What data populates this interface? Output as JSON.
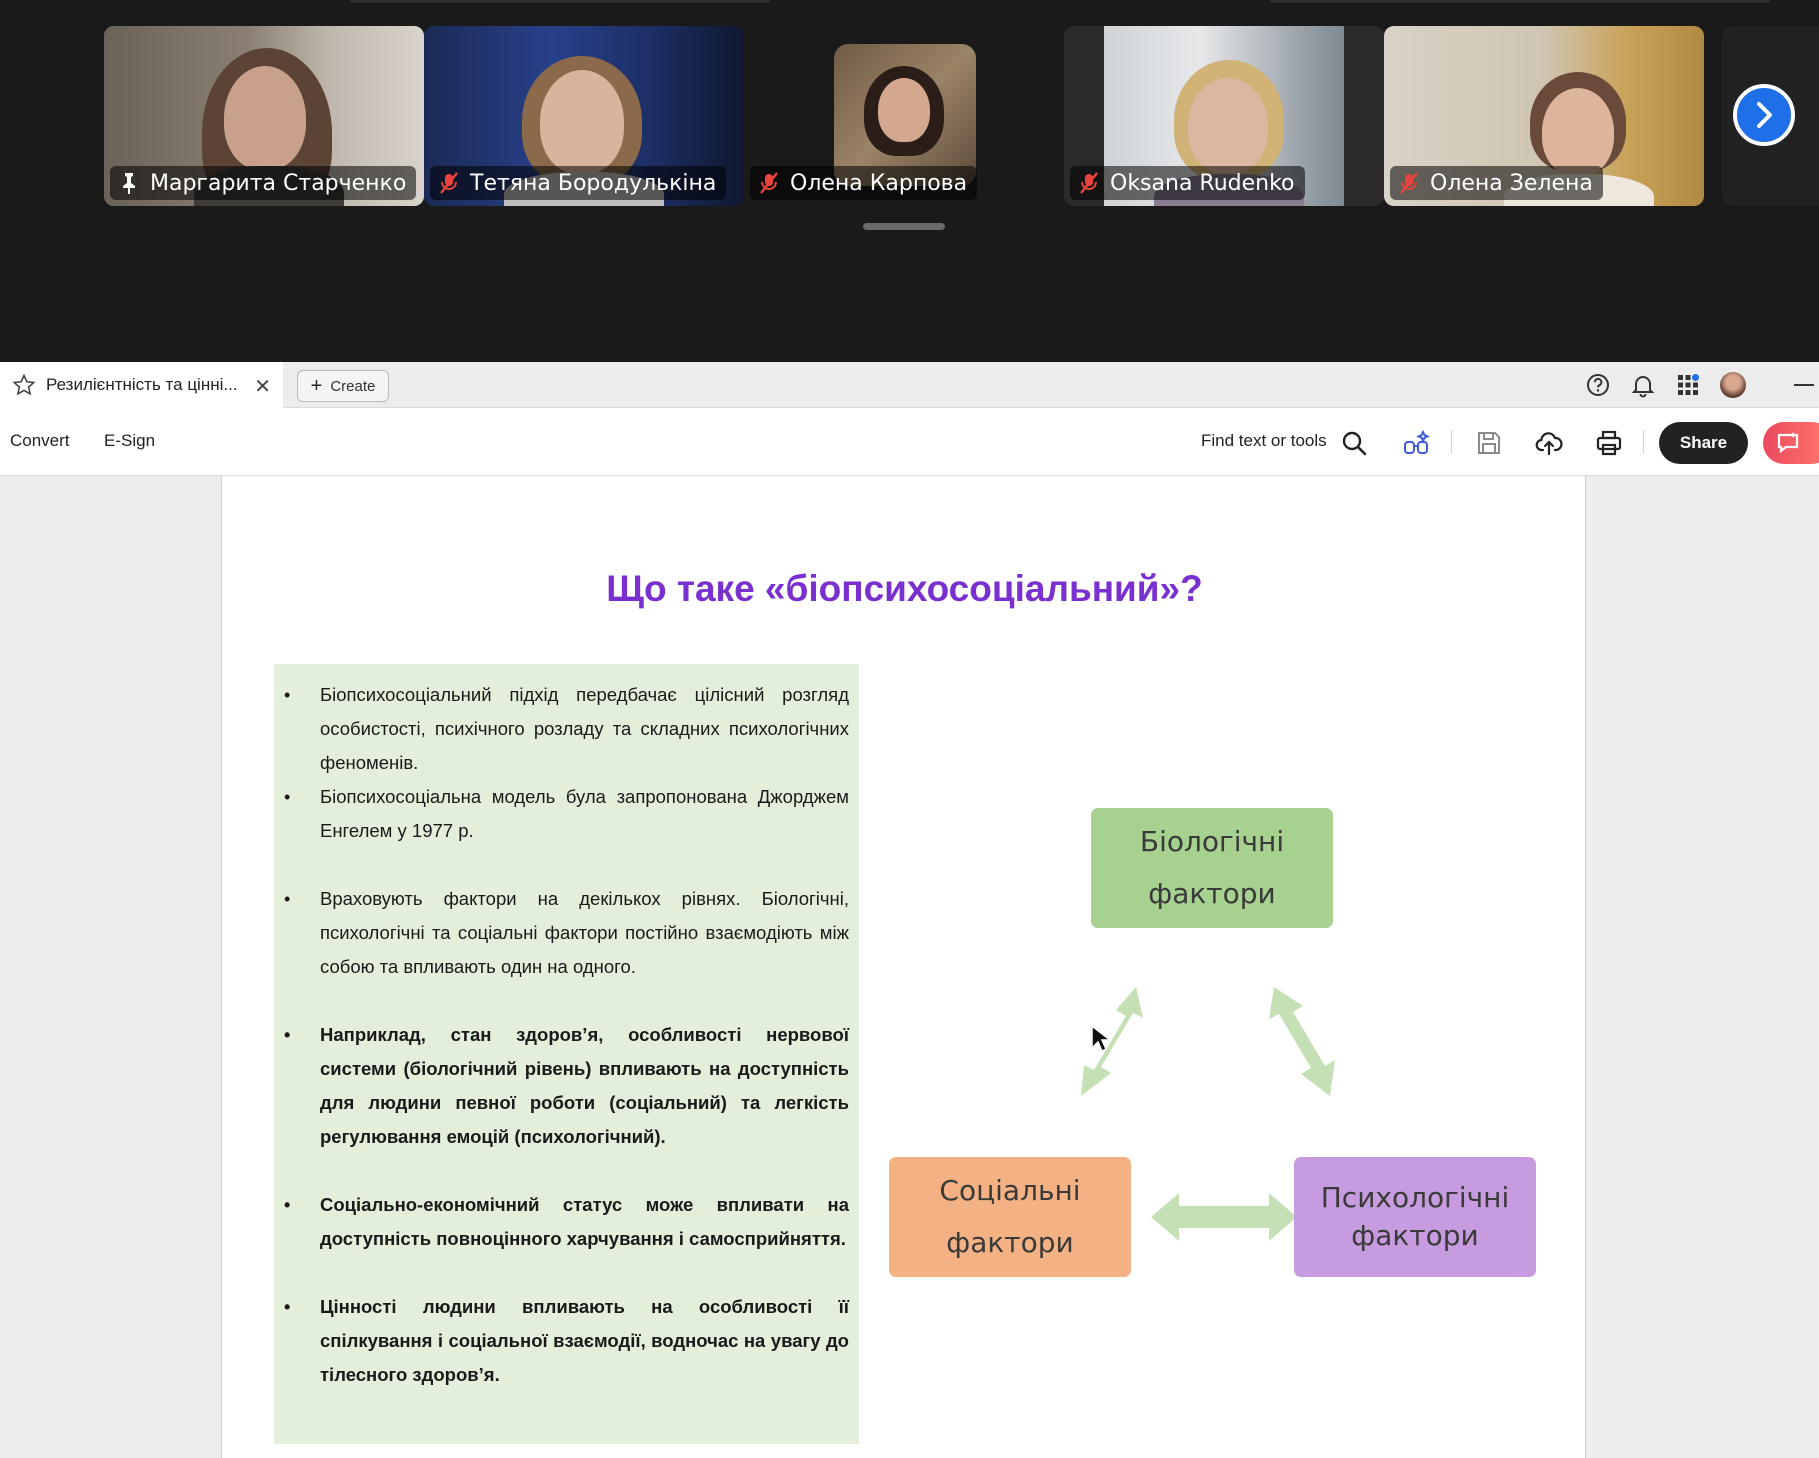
{
  "meeting": {
    "participants": [
      {
        "name": "Маргарита Старченко",
        "status_icon": "pin-icon",
        "active": true
      },
      {
        "name": "Тетяна Бородулькіна",
        "status_icon": "mic-muted-icon",
        "active": false
      },
      {
        "name": "Олена Карпова",
        "status_icon": "mic-muted-icon",
        "active": false
      },
      {
        "name": "Oksana Rudenko",
        "status_icon": "mic-muted-icon",
        "active": false
      },
      {
        "name": "Олена Зелена",
        "status_icon": "mic-muted-icon",
        "active": false
      }
    ],
    "active_speaker_color": "#2fd37a",
    "next_icon": "chevron-right-icon"
  },
  "acrobat": {
    "tab": {
      "title": "Резилієнтність та цінні...",
      "star_icon": "star-icon",
      "close_icon": "close-icon"
    },
    "create_label": "Create",
    "titlebar_icons": [
      "help-icon",
      "bell-icon",
      "apps-grid-icon",
      "avatar",
      "minimize-icon"
    ],
    "toolbar": {
      "convert_label": "Convert",
      "esign_label": "E-Sign",
      "find_label": "Find text or tools",
      "share_label": "Share",
      "icons": [
        "search-icon",
        "ai-assistant-icon",
        "save-icon",
        "cloud-upload-icon",
        "print-icon"
      ]
    }
  },
  "slide": {
    "title": "Що таке «біопсихосоціальний»?",
    "bullets": [
      {
        "text": "Біопсихосоціальний підхід передбачає цілісний розгляд особистості, психічного розладу та складних психологічних феноменів.",
        "bold": false,
        "gap": false
      },
      {
        "text": "Біопсихосоціальна модель була запропонована Джорджем Енгелем у 1977 р.",
        "bold": false,
        "gap": false
      },
      {
        "text": "Враховують фактори на декількох рівнях. Біологічні, психологічні та соціальні фактори постійно взаємодіють між собою та впливають один на одного.",
        "bold": false,
        "gap": true
      },
      {
        "text": "Наприклад, стан здоров’я, особливості нервової системи (біологічний рівень) впливають на доступність для людини певної роботи (соціальний) та легкість регулювання емоцій (психологічний).",
        "bold": true,
        "gap": true
      },
      {
        "text": "Соціально-економічний статус може впливати на доступність повноцінного харчування і самосприйняття.",
        "bold": true,
        "gap": true
      },
      {
        "text": "Цінності людини впливають на особливості її спілкування і соціальної взаємодії, водночас на увагу до тілесного здоров’я.",
        "bold": true,
        "gap": true
      }
    ],
    "diagram": {
      "bio_line1": "Біологічні",
      "bio_line2": "фактори",
      "soc_line1": "Соціальні",
      "soc_line2": "фактори",
      "psy_line1": "Психологічні",
      "psy_line2": "фактори",
      "colors": {
        "bio": "#a6d18e",
        "soc": "#f4b183",
        "psy": "#c79bdf",
        "arrow": "#c5e0b4"
      }
    }
  }
}
